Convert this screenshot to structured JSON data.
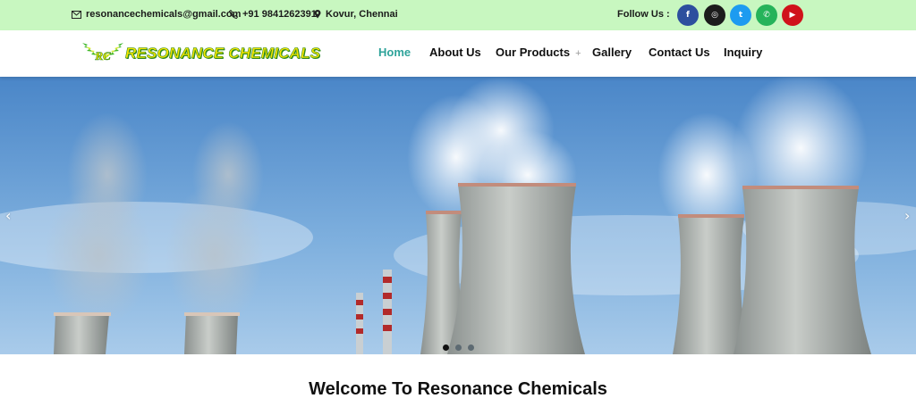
{
  "topbar": {
    "email": "resonancechemicals@gmail.com",
    "phone": "+91 9841262391",
    "location": "Kovur, Chennai",
    "follow_label": "Follow Us :",
    "social": [
      {
        "icon": "facebook-icon",
        "glyph": "f",
        "color": "#2d4f9e"
      },
      {
        "icon": "instagram-icon",
        "glyph": "◎",
        "color": "#1c1c1c"
      },
      {
        "icon": "twitter-icon",
        "glyph": "t",
        "color": "#1d9bf0"
      },
      {
        "icon": "whatsapp-icon",
        "glyph": "✆",
        "color": "#25b35a"
      },
      {
        "icon": "youtube-icon",
        "glyph": "▶",
        "color": "#d0121b"
      }
    ]
  },
  "header": {
    "logo_text": "RESONANCE CHEMICALS",
    "logo_mark": "RC",
    "nav": [
      {
        "label": "Home",
        "active": true
      },
      {
        "label": "About Us",
        "active": false
      },
      {
        "label": "Our Products",
        "active": false,
        "has_dropdown": true,
        "dropdown_glyph": "+"
      },
      {
        "label": "Gallery",
        "active": false
      },
      {
        "label": "Contact Us",
        "active": false
      },
      {
        "label": "Inquiry",
        "active": false
      }
    ]
  },
  "hero": {
    "image": "cooling towers with steam under blue sky",
    "prev_glyph": "‹",
    "next_glyph": "›",
    "slide_count": 3,
    "active_slide": 1
  },
  "welcome": {
    "heading": "Welcome To Resonance Chemicals"
  },
  "colors": {
    "topbar_bg": "#c8f7c0",
    "nav_active": "#2ea39a",
    "logo_yellow": "#f5e400",
    "logo_green": "#2e8b1e"
  }
}
